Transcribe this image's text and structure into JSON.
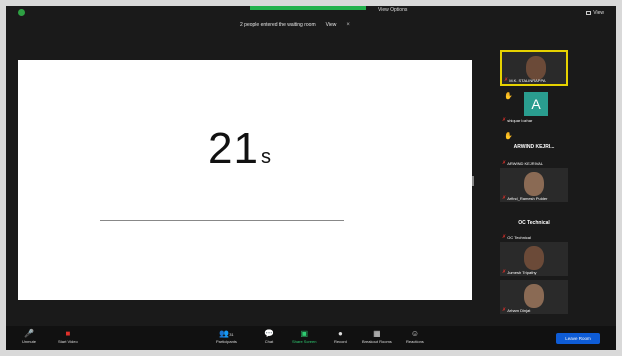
{
  "notice": {
    "text": "2 people entered the waiting room",
    "view_label": "View"
  },
  "topbar": {
    "view_options_label": "View Options",
    "gallery_label": "View"
  },
  "share": {
    "timer_value": "21",
    "timer_unit": "s"
  },
  "participants": [
    {
      "name": "M.K. STALINRAPPA",
      "muted": true
    },
    {
      "name": "shiquar lozhar",
      "letter": "A",
      "muted": true
    },
    {
      "name": "ARWIND KEJRI...",
      "display_only": true
    },
    {
      "name": "ARWIND KEJRIVAL",
      "muted": true
    },
    {
      "name": "Arfind_Ramesh Pulder",
      "muted": true
    },
    {
      "name": "OC Technical",
      "display_only": true
    },
    {
      "name": "OC Technical",
      "muted": true
    },
    {
      "name": "Jumesh Tripathy",
      "muted": true
    },
    {
      "name": "Arham Dinjat",
      "muted": true
    }
  ],
  "toolbar": {
    "unmute": "Unmute",
    "start_video": "Start Video",
    "participants": "Participants",
    "participants_count": "31",
    "chat": "Chat",
    "share_screen": "Share Screen",
    "record": "Record",
    "breakout_rooms": "Breakout Rooms",
    "reactions": "Reactions",
    "leave": "Leave Room"
  },
  "colors": {
    "accent_green": "#22b14c",
    "leave_blue": "#0e5cd6",
    "active_speaker": "#e6d200",
    "muted_red": "#e0302a"
  }
}
